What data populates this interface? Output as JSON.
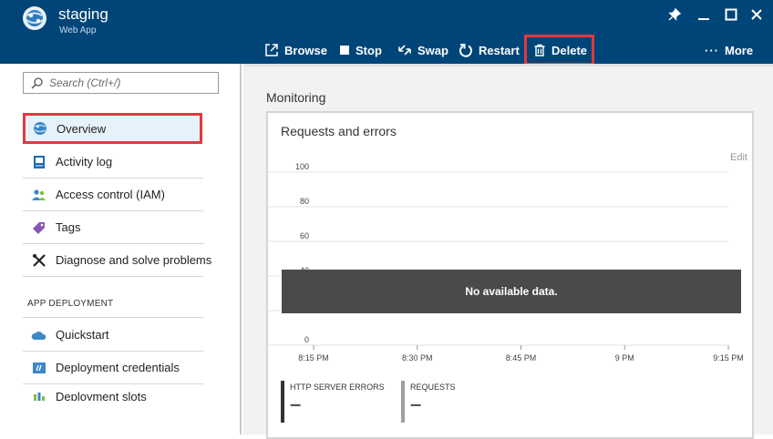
{
  "header": {
    "title": "staging",
    "subtitle": "Web App",
    "logo_icon": "globe-cube-icon",
    "window_controls": [
      "pin-icon",
      "minimize-icon",
      "maximize-icon",
      "close-icon"
    ]
  },
  "toolbar": {
    "browse": "Browse",
    "stop": "Stop",
    "swap": "Swap",
    "restart": "Restart",
    "delete": "Delete",
    "more": "More",
    "more_glyph": "···"
  },
  "sidebar": {
    "search_placeholder": "Search (Ctrl+/)",
    "items": [
      {
        "label": "Overview",
        "icon": "globe-icon",
        "active": true
      },
      {
        "label": "Activity log",
        "icon": "activity-log-icon"
      },
      {
        "label": "Access control (IAM)",
        "icon": "users-icon"
      },
      {
        "label": "Tags",
        "icon": "tag-icon"
      },
      {
        "label": "Diagnose and solve problems",
        "icon": "tools-icon"
      }
    ],
    "section": "APP DEPLOYMENT",
    "deploy_items": [
      {
        "label": "Quickstart",
        "icon": "cloud-icon"
      },
      {
        "label": "Deployment credentials",
        "icon": "credentials-icon"
      },
      {
        "label": "Deployment slots",
        "icon": "slots-icon"
      }
    ]
  },
  "main": {
    "section_title": "Monitoring",
    "card_title": "Requests and errors",
    "edit_label": "Edit",
    "no_data": "No available data."
  },
  "chart_data": {
    "type": "line",
    "title": "Requests and errors",
    "ylim": [
      0,
      100
    ],
    "y_ticks": [
      "100",
      "80",
      "60",
      "40",
      "20",
      "0"
    ],
    "x_ticks": [
      "8:15 PM",
      "8:30 PM",
      "8:45 PM",
      "9 PM",
      "9:15 PM"
    ],
    "series": [
      {
        "name": "HTTP SERVER ERRORS",
        "value": "–",
        "color": "#333333",
        "values": []
      },
      {
        "name": "REQUESTS",
        "value": "–",
        "color": "#a0a0a0",
        "values": []
      }
    ]
  },
  "colors": {
    "header_bg": "#004578",
    "highlight_border": "#e0393e",
    "active_bg": "#e6f2f9"
  }
}
